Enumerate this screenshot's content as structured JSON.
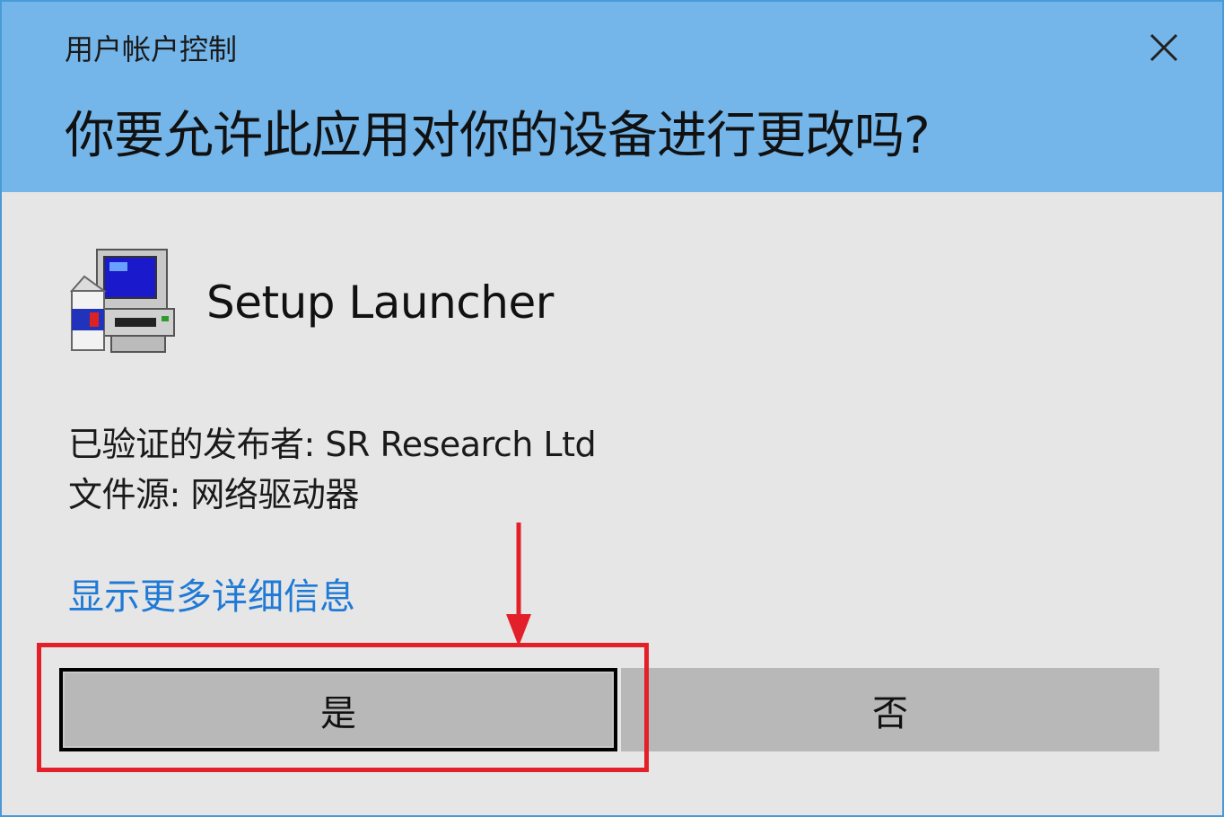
{
  "header": {
    "title": "用户帐户控制",
    "question": "你要允许此应用对你的设备进行更改吗?",
    "close_icon": "close-icon"
  },
  "app": {
    "icon": "setup-launcher-icon",
    "name": "Setup Launcher"
  },
  "details": {
    "publisher_label": "已验证的发布者:",
    "publisher_value": "SR Research Ltd",
    "source_label": "文件源:",
    "source_value": "网络驱动器"
  },
  "more_link": "显示更多详细信息",
  "buttons": {
    "yes": "是",
    "no": "否"
  },
  "annotation": {
    "color": "#e3202a",
    "target": "yes-button"
  },
  "colors": {
    "header_bg": "#74b6ea",
    "body_bg": "#e6e6e6",
    "link": "#1f7ad6",
    "button_bg": "#b8b8b8"
  }
}
